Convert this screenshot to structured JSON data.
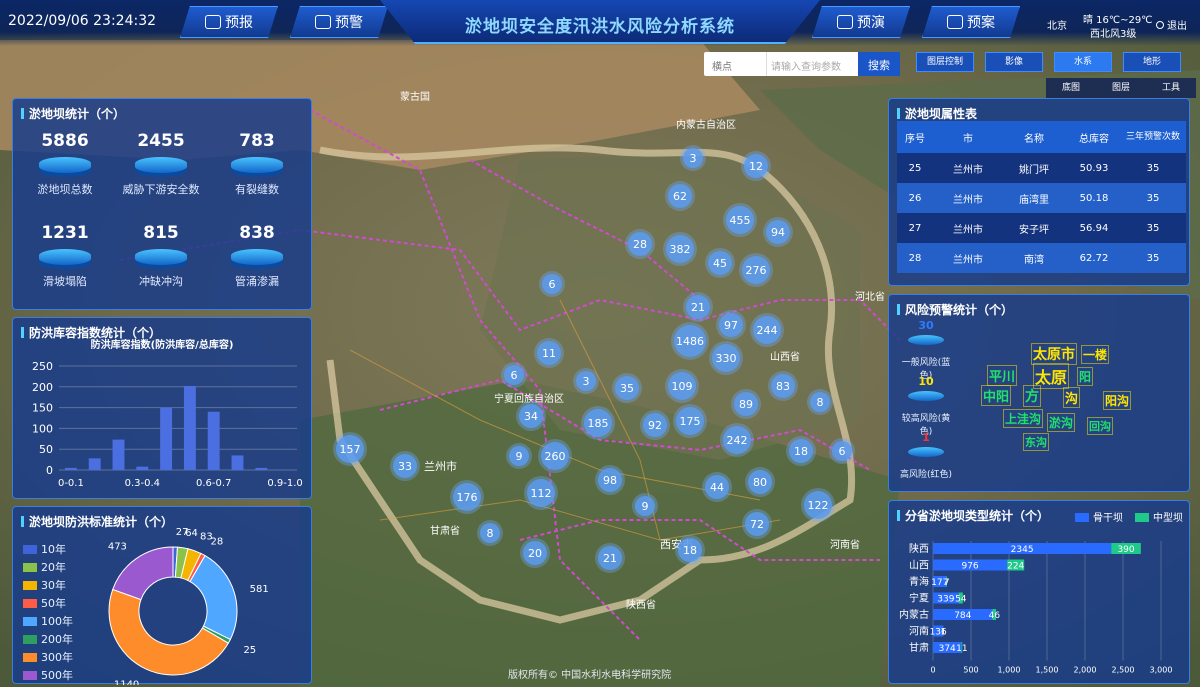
{
  "header": {
    "datetime": "2022/09/06 23:24:32",
    "title": "淤地坝安全度汛洪水风险分析系统",
    "nav_left": [
      "预报",
      "预警"
    ],
    "nav_right": [
      "预演",
      "预案"
    ],
    "city": "北京",
    "weather_line1": "晴 16℃~29℃",
    "weather_line2": "西北风3级",
    "logout": "退出"
  },
  "search": {
    "select_label": "横点",
    "placeholder": "请输入查询参数",
    "button": "搜索"
  },
  "layer_tabs": [
    "图层控制",
    "影像",
    "水系",
    "地形"
  ],
  "map_tools": [
    "底图",
    "图层",
    "工具"
  ],
  "map_labels": [
    "蒙古国",
    "内蒙古自治区",
    "宁夏回族自治区",
    "兰州市",
    "甘肃省",
    "山西省",
    "西安市",
    "陕西省",
    "河南省",
    "河北省"
  ],
  "clusters": [
    "3",
    "12",
    "62",
    "455",
    "94",
    "28",
    "382",
    "45",
    "276",
    "6",
    "21",
    "97",
    "244",
    "1486",
    "11",
    "330",
    "6",
    "3",
    "35",
    "109",
    "83",
    "34",
    "89",
    "8",
    "185",
    "92",
    "175",
    "242",
    "157",
    "9",
    "260",
    "18",
    "6",
    "33",
    "98",
    "80",
    "44",
    "176",
    "112",
    "9",
    "122",
    "72",
    "8",
    "20",
    "21",
    "18"
  ],
  "stats_panel": {
    "title": "淤地坝统计（个）",
    "items": [
      {
        "value": "5886",
        "label": "淤地坝总数"
      },
      {
        "value": "2455",
        "label": "威胁下游安全数"
      },
      {
        "value": "783",
        "label": "有裂缝数"
      },
      {
        "value": "1231",
        "label": "滑坡塌陷"
      },
      {
        "value": "815",
        "label": "冲缺冲沟"
      },
      {
        "value": "838",
        "label": "管涌渗漏"
      }
    ]
  },
  "capacity_panel": {
    "title": "防洪库容指数统计（个）",
    "chart_data": {
      "type": "bar",
      "title": "防洪库容指数(防洪库容/总库容)",
      "categories": [
        "0-0.1",
        "0.1-0.2",
        "0.2-0.3",
        "0.3-0.4",
        "0.4-0.5",
        "0.5-0.6",
        "0.6-0.7",
        "0.7-0.8",
        "0.8-0.9",
        "0.9-1.0"
      ],
      "visible_tick_labels": [
        "0-0.1",
        "0.3-0.4",
        "0.6-0.7",
        "0.9-1.0"
      ],
      "values": [
        5,
        28,
        73,
        8,
        150,
        202,
        140,
        35,
        5,
        0
      ],
      "ylim": [
        0,
        250
      ],
      "yticks": [
        0,
        50,
        100,
        150,
        200,
        250
      ],
      "color": "#4b6fe0"
    }
  },
  "standard_panel": {
    "title": "淤地坝防洪标准统计（个）",
    "chart_data": {
      "type": "pie",
      "categories": [
        "10年",
        "20年",
        "30年",
        "50年",
        "100年",
        "200年",
        "300年",
        "500年"
      ],
      "values": [
        27,
        64,
        83,
        28,
        581,
        25,
        1140,
        473
      ],
      "colors": [
        "#3f63d8",
        "#8bc34a",
        "#f5b400",
        "#ff5b45",
        "#4fa7ff",
        "#2e9e62",
        "#ff8c2a",
        "#9b59d0"
      ],
      "legend": "left"
    }
  },
  "attr_panel": {
    "title": "淤地坝属性表",
    "columns": [
      "序号",
      "市",
      "名称",
      "总库容",
      "三年预警次数"
    ],
    "rows": [
      [
        "25",
        "兰州市",
        "姚门坪",
        "50.93",
        "35"
      ],
      [
        "26",
        "兰州市",
        "庙湾里",
        "50.18",
        "35"
      ],
      [
        "27",
        "兰州市",
        "安子坪",
        "56.94",
        "35"
      ],
      [
        "28",
        "兰州市",
        "南湾",
        "62.72",
        "35"
      ]
    ]
  },
  "risk_panel": {
    "title": "风险预警统计（个）",
    "items": [
      {
        "value": "30",
        "label": "一般风险(蓝色)",
        "color": "#2e7bff"
      },
      {
        "value": "10",
        "label": "较高风险(黄色)",
        "color": "#ffe600"
      },
      {
        "value": "1",
        "label": "高风险(红色)",
        "color": "#ff3030"
      }
    ],
    "cloud_words": [
      "太原市",
      "一楼",
      "平川",
      "太原",
      "阳",
      "中阳",
      "方",
      "沟",
      "阳沟",
      "上洼沟",
      "淤沟",
      "回沟",
      "东沟"
    ]
  },
  "province_panel": {
    "title": "分省淤地坝类型统计（个）",
    "chart_data": {
      "type": "bar",
      "orientation": "horizontal",
      "categories": [
        "陕西",
        "山西",
        "青海",
        "宁夏",
        "内蒙古",
        "河南",
        "甘肃"
      ],
      "series": [
        {
          "name": "骨干坝",
          "values": [
            2345,
            976,
            177,
            339,
            784,
            136,
            374
          ],
          "color": "#2a6bff"
        },
        {
          "name": "中型坝",
          "values": [
            390,
            224,
            7,
            54,
            46,
            1,
            11
          ],
          "color": "#1ec98a"
        }
      ],
      "xlim": [
        0,
        3000
      ],
      "xticks": [
        0,
        500,
        1000,
        1500,
        2000,
        2500,
        3000
      ],
      "legend": "top-right"
    }
  },
  "footer": {
    "copyright": "版权所有© 中国水利水电科学研究院"
  }
}
